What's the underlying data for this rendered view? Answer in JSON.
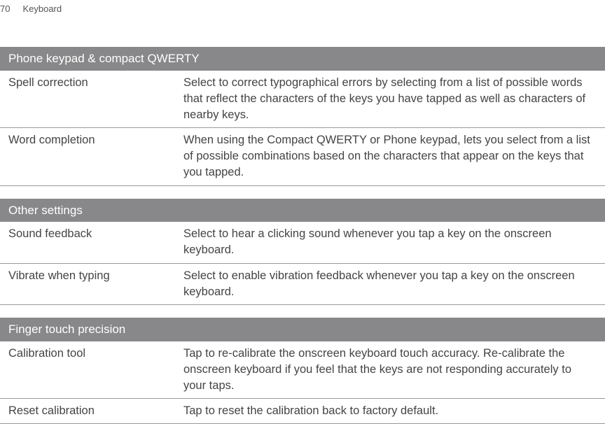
{
  "page_number": "70",
  "page_title": "Keyboard",
  "sections": [
    {
      "title": "Phone keypad & compact QWERTY",
      "rows": [
        {
          "label": "Spell correction",
          "desc": "Select to correct typographical errors by selecting from a list of possible words that reflect the characters of the keys you have tapped as well as characters of nearby keys."
        },
        {
          "label": "Word completion",
          "desc": "When using the Compact QWERTY or Phone keypad, lets you select from a list of possible combinations based on the characters that appear on the keys that you tapped."
        }
      ]
    },
    {
      "title": "Other settings",
      "rows": [
        {
          "label": "Sound feedback",
          "desc": "Select to hear a clicking sound whenever you tap a key on the onscreen keyboard."
        },
        {
          "label": "Vibrate when typing",
          "desc": "Select to enable vibration feedback whenever you tap a key on the onscreen keyboard."
        }
      ]
    },
    {
      "title": "Finger touch precision",
      "rows": [
        {
          "label": "Calibration tool",
          "desc": "Tap to re-calibrate the onscreen keyboard touch accuracy. Re-calibrate the onscreen keyboard if you feel that the keys are not responding accurately to your taps."
        },
        {
          "label": "Reset calibration",
          "desc": "Tap to reset the calibration back to factory default."
        }
      ]
    }
  ]
}
